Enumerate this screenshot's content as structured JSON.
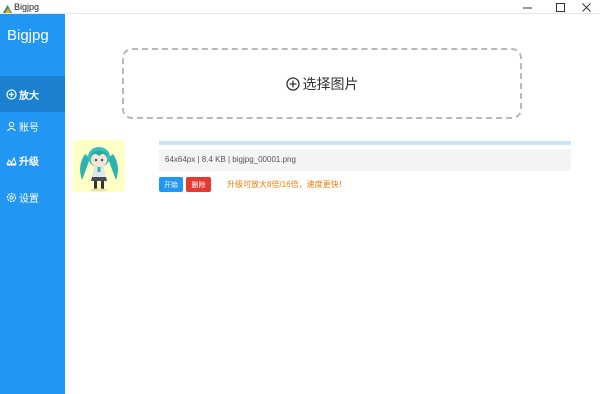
{
  "window": {
    "title": "Bigjpg"
  },
  "sidebar": {
    "brand": "Bigjpg",
    "items": [
      {
        "label": "放大",
        "icon": "plus-circle-icon",
        "active": true
      },
      {
        "label": "账号",
        "icon": "user-icon",
        "active": false
      },
      {
        "label": "升级",
        "icon": "upgrade-icon",
        "active": false
      },
      {
        "label": "设置",
        "icon": "gear-icon",
        "active": false
      }
    ]
  },
  "upload": {
    "label": "选择图片",
    "icon": "plus-circle-icon"
  },
  "file": {
    "info": "64x64px | 8.4 KB | bigjpg_00001.png",
    "thumbnail": "anime-figure-thumbnail",
    "progress": 1.0
  },
  "actions": {
    "start_label": "开始",
    "delete_label": "删除"
  },
  "tip": "升级可放大8倍/16倍，速度更快！",
  "colors": {
    "sidebar": "#2196f3",
    "sidebar_active": "#1b80cf",
    "start": "#2196f3",
    "delete": "#e53935",
    "tip": "#f57c00"
  }
}
